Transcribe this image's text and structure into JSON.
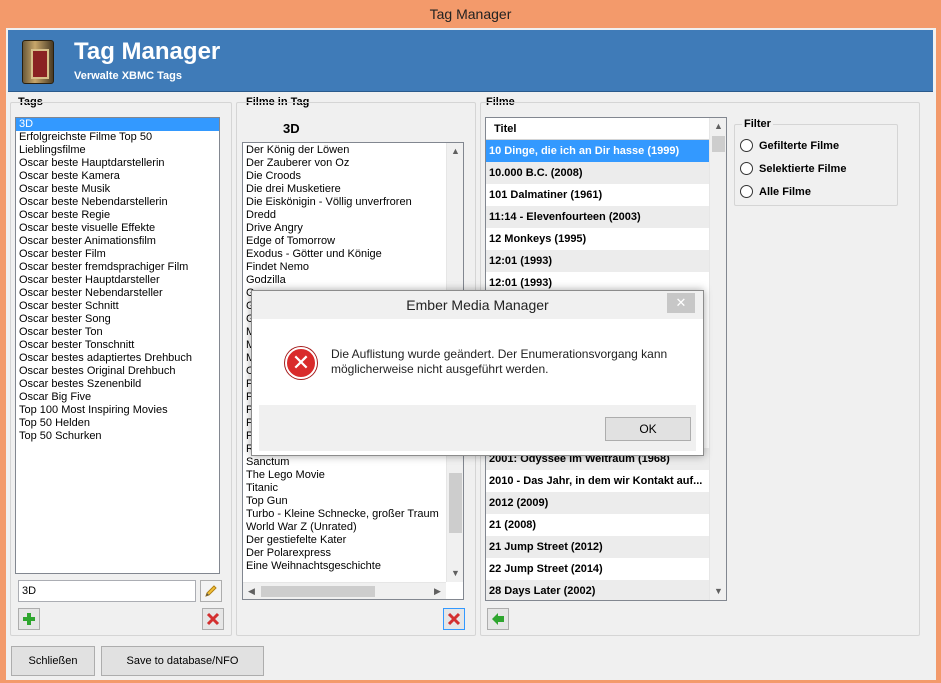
{
  "window": {
    "title": "Tag Manager"
  },
  "header": {
    "title": "Tag Manager",
    "subtitle": "Verwalte XBMC Tags"
  },
  "tags": {
    "label": "Tags",
    "items": [
      "3D",
      "Erfolgreichste Filme Top 50",
      "Lieblingsfilme",
      "Oscar beste Hauptdarstellerin",
      "Oscar beste Kamera",
      "Oscar beste Musik",
      "Oscar beste Nebendarstellerin",
      "Oscar beste Regie",
      "Oscar beste visuelle Effekte",
      "Oscar bester Animationsfilm",
      "Oscar bester Film",
      "Oscar bester fremdsprachiger Film",
      "Oscar bester Hauptdarsteller",
      "Oscar bester Nebendarsteller",
      "Oscar bester Schnitt",
      "Oscar bester Song",
      "Oscar bester Ton",
      "Oscar bester Tonschnitt",
      "Oscar bestes adaptiertes Drehbuch",
      "Oscar bestes Original Drehbuch",
      "Oscar bestes Szenenbild",
      "Oscar Big Five",
      "Top 100 Most Inspiring Movies",
      "Top 50 Helden",
      "Top 50 Schurken"
    ],
    "input_value": "3D"
  },
  "movies_in_tag": {
    "label": "Filme in Tag",
    "current_tag": "3D",
    "items": [
      "Der König der Löwen",
      "Der Zauberer von Oz",
      "Die Croods",
      "Die drei Musketiere",
      "Die Eiskönigin - Völlig unverfroren",
      "Dredd",
      "Drive Angry",
      "Edge of Tomorrow",
      "Exodus - Götter und Könige",
      "Findet Nemo",
      "Godzilla",
      "G",
      "G",
      "G",
      "M",
      "M",
      "M",
      "O",
      "P",
      "P",
      "P",
      "P",
      "P",
      "Ratatouille",
      "Sanctum",
      "The Lego Movie",
      "Titanic",
      "Top Gun",
      "Turbo - Kleine Schnecke, großer Traum",
      "World War Z (Unrated)",
      "Der gestiefelte Kater",
      "Der Polarexpress",
      "Eine Weihnachtsgeschichte"
    ]
  },
  "movies": {
    "label": "Filme",
    "column_title": "Titel",
    "rows_top": [
      "10 Dinge, die ich an Dir hasse (1999)",
      "10.000 B.C. (2008)",
      "101 Dalmatiner (1961)",
      "11:14 - Elevenfourteen (2003)",
      "12 Monkeys (1995)",
      "12:01 (1993)",
      "12:01 (1993)"
    ],
    "rows_bottom": [
      "2001: Odyssee im Weltraum (1968)",
      "2010 - Das Jahr, in dem wir Kontakt auf...",
      "2012 (2009)",
      "21 (2008)",
      "21 Jump Street (2012)",
      "22 Jump Street (2014)",
      "28 Days Later (2002)"
    ]
  },
  "filter": {
    "label": "Filter",
    "options": [
      "Gefilterte Filme",
      "Selektierte Filme",
      "Alle Filme"
    ]
  },
  "buttons": {
    "close": "Schließen",
    "save": "Save to database/NFO"
  },
  "dialog": {
    "title": "Ember Media Manager",
    "close_glyph": "✕",
    "message_line1": "Die Auflistung wurde geändert. Der Enumerationsvorgang kann",
    "message_line2": "möglicherweise nicht ausgeführt werden.",
    "ok": "OK"
  },
  "icons": {
    "add": "plus-icon",
    "delete": "x-icon",
    "rename": "pencil-icon",
    "move_left": "arrow-left-icon",
    "error": "error-icon"
  },
  "colors": {
    "title_bar": "#f39a6b",
    "header": "#3f7bb8",
    "selection": "#3399ff",
    "error": "#d92b2b",
    "add_green": "#2fa62f",
    "delete_red": "#d32f2f"
  }
}
